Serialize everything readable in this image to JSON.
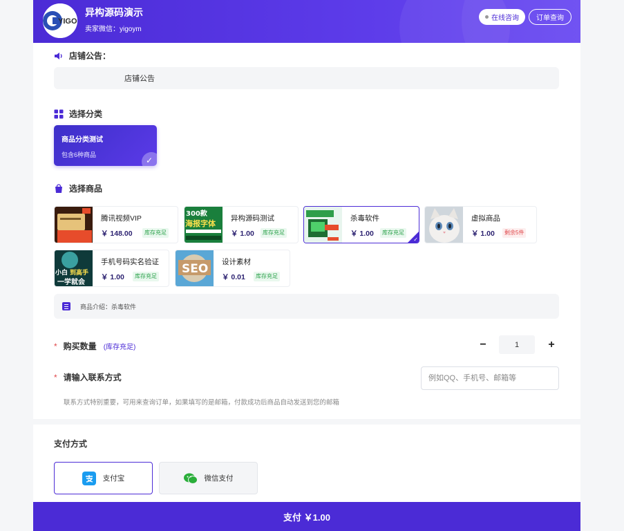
{
  "header": {
    "shop_name": "异构源码演示",
    "wechat": "卖家微信：yigoym",
    "consult_label": "在线咨询",
    "orders_label": "订单查询",
    "logo_text": "YIGO"
  },
  "notice": {
    "title": "店铺公告：",
    "content": "店铺公告"
  },
  "category": {
    "title": "选择分类",
    "items": [
      {
        "name": "商品分类测试",
        "count": "包含6种商品",
        "selected": true
      }
    ]
  },
  "products": {
    "title": "选择商品",
    "items": [
      {
        "name": "腾讯视频VIP",
        "price": "￥ 148.00",
        "stock": "库存充足",
        "stock_state": "ok",
        "selected": false
      },
      {
        "name": "异构源码测试",
        "price": "￥ 1.00",
        "stock": "库存充足",
        "stock_state": "ok",
        "selected": false
      },
      {
        "name": "杀毒软件",
        "price": "￥ 1.00",
        "stock": "库存充足",
        "stock_state": "ok",
        "selected": true
      },
      {
        "name": "虚拟商品",
        "price": "￥ 1.00",
        "stock": "剩余5件",
        "stock_state": "low",
        "selected": false
      },
      {
        "name": "手机号码实名验证",
        "price": "￥ 1.00",
        "stock": "库存充足",
        "stock_state": "ok",
        "selected": false
      },
      {
        "name": "设计素材",
        "price": "￥ 0.01",
        "stock": "库存充足",
        "stock_state": "ok",
        "selected": false
      }
    ],
    "thumb_texts": {
      "p2_line1": "300款",
      "p2_line2": "海报字体",
      "p4_line1": "小白",
      "p4_line2": "到高手",
      "p4_line3": "一学就会",
      "p5": "SEO"
    },
    "intro": "商品介绍：杀毒软件"
  },
  "quantity": {
    "label": "购买数量",
    "note": "(库存充足)",
    "value": "1",
    "minus": "−",
    "plus": "+"
  },
  "contact": {
    "label": "请输入联系方式",
    "placeholder": "例如QQ、手机号、邮箱等",
    "hint": "联系方式特别重要，可用来查询订单，如果填写的是邮箱，付款成功后商品自动发送到您的邮箱"
  },
  "payment": {
    "title": "支付方式",
    "methods": [
      {
        "name": "支付宝",
        "selected": true
      },
      {
        "name": "微信支付",
        "selected": false
      }
    ],
    "pay_button": "支付 ￥1.00"
  },
  "required_mark": "*",
  "colors": {
    "brand": "#4b2bd6",
    "stock_ok": "#2aa14a",
    "stock_low": "#e0484b"
  }
}
